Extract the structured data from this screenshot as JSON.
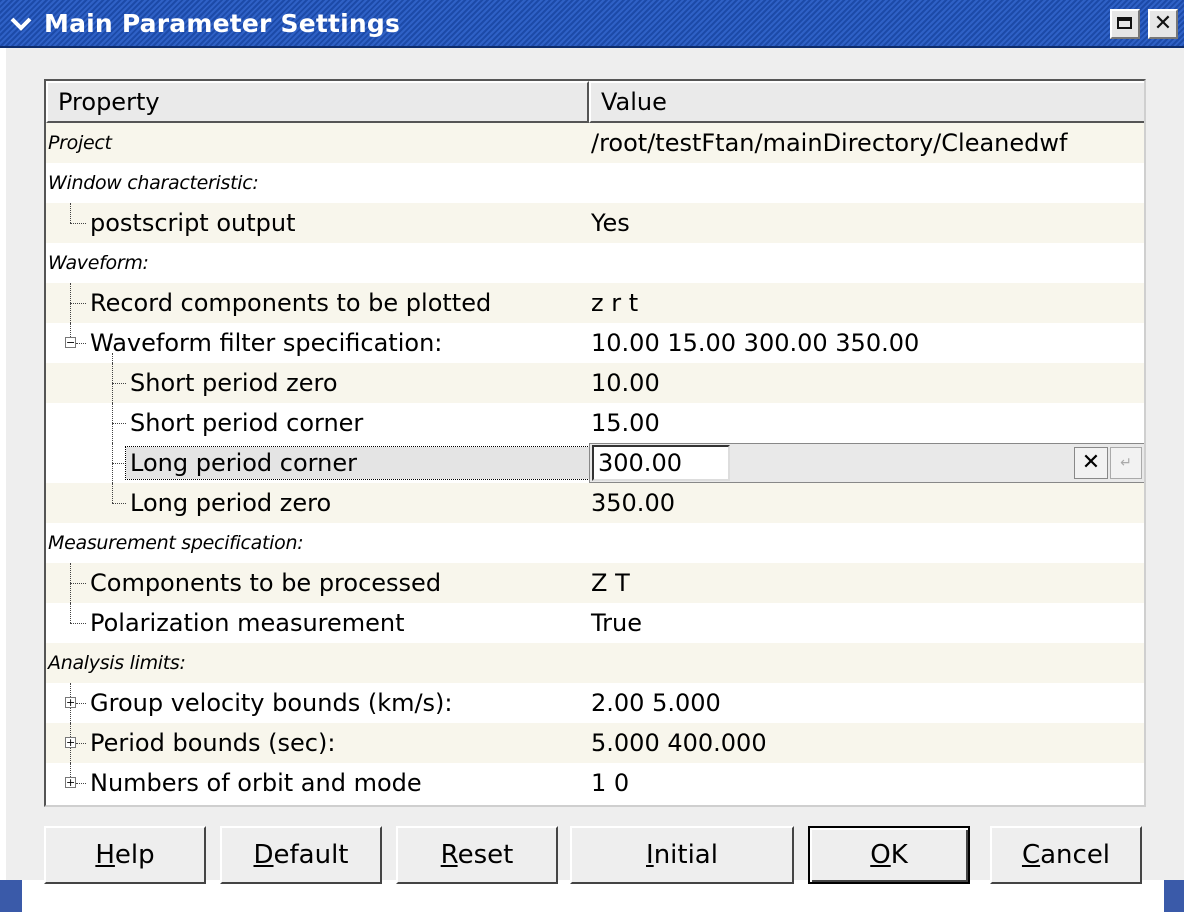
{
  "window": {
    "title": "Main Parameter Settings",
    "menu_icon": "chevron-down-icon",
    "close_glyph": "✕"
  },
  "table": {
    "headers": {
      "property": "Property",
      "value": "Value"
    },
    "rows": [
      {
        "label": "Project",
        "value": "/root/testFtan/mainDirectory/Cleanedwf"
      },
      {
        "label": "Window characteristic:",
        "value": ""
      },
      {
        "label": "postscript output",
        "value": "Yes"
      },
      {
        "label": "Waveform:",
        "value": ""
      },
      {
        "label": "Record components to be plotted",
        "value": "z r t"
      },
      {
        "label": "Waveform filter specification:",
        "value": "10.00  15.00  300.00  350.00",
        "expander": "−"
      },
      {
        "label": "Short period zero",
        "value": "10.00"
      },
      {
        "label": "Short period corner",
        "value": "15.00"
      },
      {
        "label": "Long period corner",
        "value": "300.00",
        "editing": true
      },
      {
        "label": "Long period zero",
        "value": "350.00"
      },
      {
        "label": "Measurement specification:",
        "value": ""
      },
      {
        "label": "Components to be processed",
        "value": "Z T"
      },
      {
        "label": "Polarization measurement",
        "value": "True"
      },
      {
        "label": "Analysis limits:",
        "value": ""
      },
      {
        "label": "Group velocity bounds (km/s):",
        "value": "2.00  5.000",
        "expander": "+"
      },
      {
        "label": "Period bounds (sec):",
        "value": "5.000  400.000",
        "expander": "+"
      },
      {
        "label": "Numbers of orbit and mode",
        "value": "1  0",
        "expander": "+"
      }
    ],
    "editor": {
      "value": "300.00",
      "clear_glyph": "✕",
      "apply_glyph": "↵"
    }
  },
  "buttons": {
    "help": {
      "mnemonic": "H",
      "rest": "elp"
    },
    "default": {
      "mnemonic": "D",
      "rest": "efault"
    },
    "reset": {
      "mnemonic": "R",
      "rest": "eset"
    },
    "initial": {
      "mnemonic": "I",
      "rest": "nitial"
    },
    "ok": {
      "mnemonic": "O",
      "rest": "K"
    },
    "cancel": {
      "mnemonic": "C",
      "rest": "ancel"
    }
  },
  "colors": {
    "titlebar": "#2f61c6",
    "row_shade": "#f8f6ec",
    "dialog_bg": "#eeeeee"
  }
}
